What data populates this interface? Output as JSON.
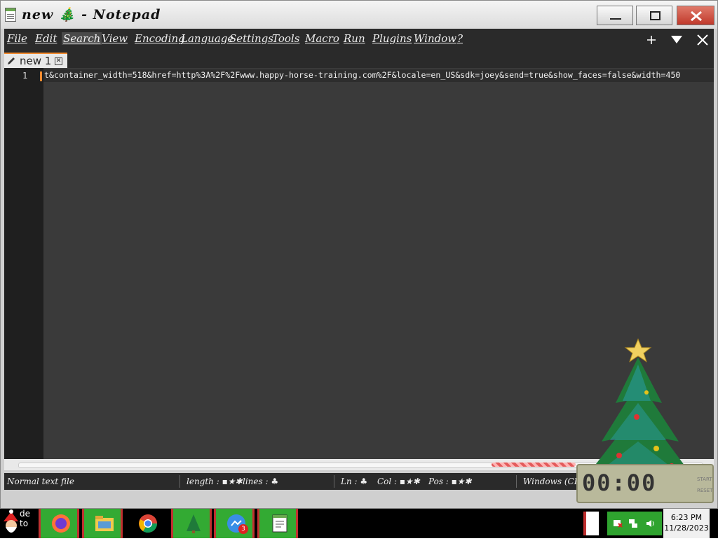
{
  "window": {
    "title": "new 🎄 - Notepad",
    "controls": {
      "minimize": "minimize",
      "maximize": "maximize",
      "close": "close"
    }
  },
  "menu": {
    "items": [
      {
        "label": "File"
      },
      {
        "label": "Edit"
      },
      {
        "label": "Search"
      },
      {
        "label": "View"
      },
      {
        "label": "Encoding"
      },
      {
        "label": "Language"
      },
      {
        "label": "Settings"
      },
      {
        "label": "Tools"
      },
      {
        "label": "Macro"
      },
      {
        "label": "Run"
      },
      {
        "label": "Plugins"
      },
      {
        "label": "Window"
      },
      {
        "label": "?"
      }
    ],
    "right_controls": {
      "add": "+",
      "dropdown": "▼",
      "close": "✕"
    }
  },
  "tabs": [
    {
      "label": "new 1",
      "close": "✕"
    }
  ],
  "editor": {
    "lines": [
      {
        "number": "1",
        "text": "t&container_width=518&href=http%3A%2F%2Fwww.happy-horse-training.com%2F&locale=en_US&sdk=joey&send=true&show_faces=false&width=450"
      }
    ]
  },
  "status": {
    "file_type": "Normal text file",
    "length": "length : ▪★✱",
    "lines": "lines : ♣",
    "ln": "Ln : ♣",
    "col": "Col : ▪★✱",
    "pos": "Pos : ▪★✱",
    "eol": "Windows (CR"
  },
  "widget": {
    "clock_digits": "00:00",
    "start": "START",
    "reset": "RESET"
  },
  "taskbar": {
    "start_text": "de\nto",
    "apps": [
      {
        "name": "firefox"
      },
      {
        "name": "file-explorer"
      },
      {
        "name": "chrome"
      },
      {
        "name": "christmas-tree"
      },
      {
        "name": "messenger",
        "badge": "3"
      },
      {
        "name": "notepad"
      }
    ],
    "time": "6:23 PM",
    "date": "11/28/2023"
  },
  "colors": {
    "accent": "#f28b30",
    "editor_bg": "#3a3a3a",
    "menu_bg": "#2a2a2a",
    "taskbar_green": "#33aa33"
  }
}
